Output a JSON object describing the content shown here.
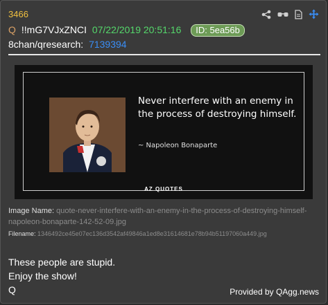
{
  "post": {
    "number": "3466",
    "q_label": "Q",
    "tripcode": "!!mG7VJxZNCI",
    "timestamp": "07/22/2019 20:51:16",
    "id_badge": "ID: 5ea56b",
    "board": "8chan/qresearch:",
    "post_link": "7139394"
  },
  "toolbar": {
    "icons": [
      "share-icon",
      "glasses-icon",
      "document-icon",
      "move-icon"
    ]
  },
  "image": {
    "quote": "Never interfere with an enemy in the process of destroying himself.",
    "author": "~ Napoleon Bonaparte",
    "brand": "AZ QUOTES"
  },
  "meta": {
    "image_name_label": "Image Name:",
    "image_name_value": "quote-never-interfere-with-an-enemy-in-the-process-of-destroying-himself-napoleon-bonaparte-142-52-09.jpg",
    "filename_label": "Filename:",
    "filename_value": "1346492ce45e07ec136d3542af49846a1ed8e31614681e78b94b51197060a449.jpg"
  },
  "message": {
    "line1": "These people are stupid.",
    "line2": "Enjoy the show!",
    "line3": "Q"
  },
  "footer": {
    "provided_by": "Provided by QAgg.news"
  },
  "colors": {
    "post_number": "#f0c040",
    "timestamp": "#55d86b",
    "id_badge_bg": "#6d9b56",
    "post_link": "#3a8ef6",
    "move_icon": "#3a8ef6"
  }
}
